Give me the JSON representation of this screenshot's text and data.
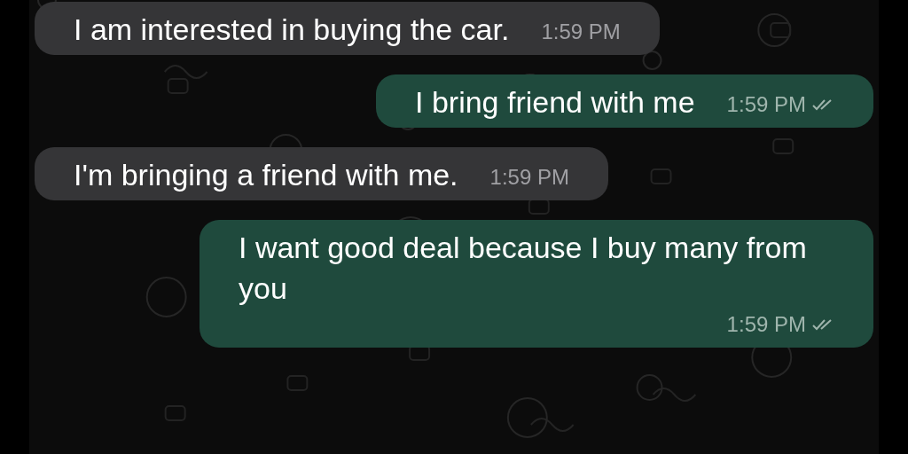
{
  "messages": [
    {
      "text": "I am interested in buying the car.",
      "time": "1:59 PM",
      "outgoing": false
    },
    {
      "text": "I bring friend with me",
      "time": "1:59 PM",
      "outgoing": true,
      "read": false
    },
    {
      "text": "I'm bringing a friend with me.",
      "time": "1:59 PM",
      "outgoing": false
    },
    {
      "text": "I want good deal because I buy many from you",
      "time": "1:59 PM",
      "outgoing": true,
      "read": false
    }
  ]
}
